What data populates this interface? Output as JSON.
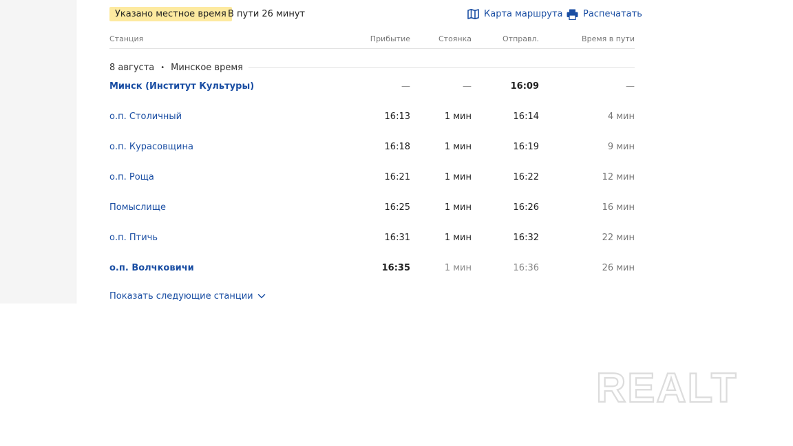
{
  "header": {
    "badge": "Указано местное время",
    "duration": "В пути 26 минут",
    "map_label": "Карта маршрута",
    "print_label": "Распечатать"
  },
  "columns": {
    "station": "Станция",
    "arrival": "Прибытие",
    "stop": "Стоянка",
    "departure": "Отправл.",
    "trip": "Время в пути"
  },
  "date_group": {
    "date": "8 августа",
    "separator": "•",
    "timezone": "Минское время"
  },
  "stations": [
    {
      "name": "Минск (Институт Культуры)",
      "arrival": "—",
      "stop": "—",
      "departure": "16:09",
      "trip": "—"
    },
    {
      "name": "о.п. Столичный",
      "arrival": "16:13",
      "stop": "1 мин",
      "departure": "16:14",
      "trip": "4 мин"
    },
    {
      "name": "о.п. Курасовщина",
      "arrival": "16:18",
      "stop": "1 мин",
      "departure": "16:19",
      "trip": "9 мин"
    },
    {
      "name": "о.п. Роща",
      "arrival": "16:21",
      "stop": "1 мин",
      "departure": "16:22",
      "trip": "12 мин"
    },
    {
      "name": "Помыслище",
      "arrival": "16:25",
      "stop": "1 мин",
      "departure": "16:26",
      "trip": "16 мин"
    },
    {
      "name": "о.п. Птичь",
      "arrival": "16:31",
      "stop": "1 мин",
      "departure": "16:32",
      "trip": "22 мин"
    },
    {
      "name": "о.п. Волчковичи",
      "arrival": "16:35",
      "stop": "1 мин",
      "departure": "16:36",
      "trip": "26 мин"
    }
  ],
  "show_more": "Показать следующие станции",
  "watermark": "REALT",
  "colors": {
    "link": "#1a4ea3",
    "badge_bg": "#fdeaa0",
    "muted": "#777777"
  },
  "icons": {
    "map": "map-icon",
    "print": "printer-icon",
    "expand": "chevron-down-icon"
  }
}
